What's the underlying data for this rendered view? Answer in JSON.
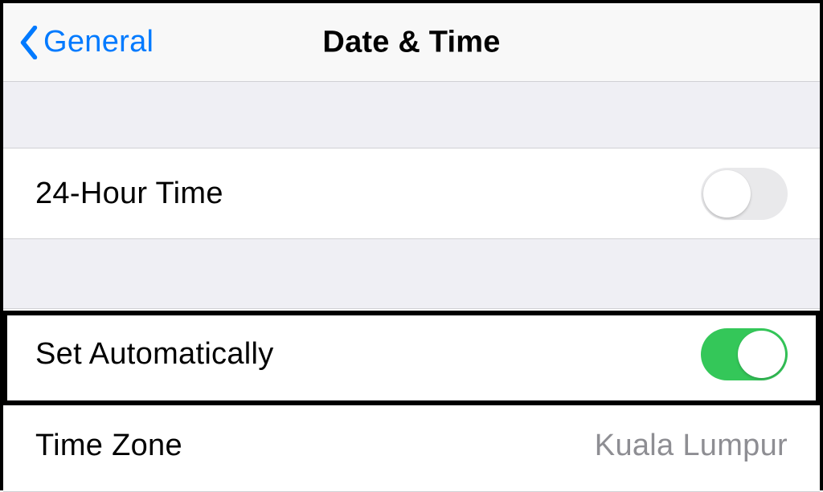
{
  "navbar": {
    "back_label": "General",
    "title": "Date & Time"
  },
  "group1": {
    "row_24h": {
      "label": "24-Hour Time",
      "switch_on": false
    }
  },
  "group2": {
    "row_auto": {
      "label": "Set Automatically",
      "switch_on": true
    },
    "row_tz": {
      "label": "Time Zone",
      "value": "Kuala Lumpur"
    }
  }
}
